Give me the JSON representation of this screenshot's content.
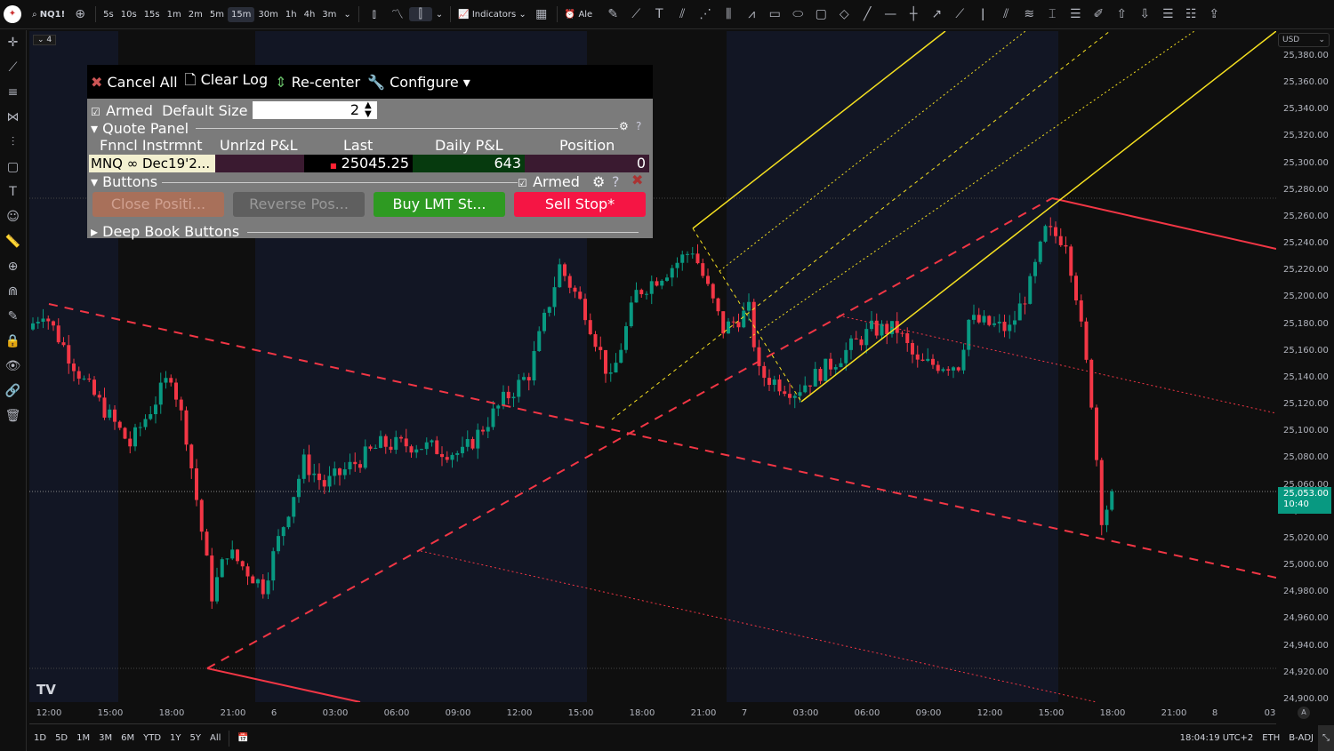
{
  "topbar": {
    "symbol": "NQ1!",
    "intervals": [
      "5s",
      "10s",
      "15s",
      "1m",
      "2m",
      "5m",
      "15m",
      "30m",
      "1h",
      "4h",
      "3m"
    ],
    "selected_interval": "15m",
    "indicators": "Indicators",
    "alert": "Ale"
  },
  "left_tools": [
    "crosshair",
    "trend-line",
    "fib",
    "pattern",
    "prediction",
    "geometric",
    "text",
    "emoji",
    "ruler",
    "zoom-in",
    "magnet",
    "draw-mode",
    "lock",
    "eye",
    "link",
    "trash"
  ],
  "panel": {
    "toolbar": {
      "cancel_all": "Cancel All",
      "clear_log": "Clear Log",
      "recenter": "Re-center",
      "configure": "Configure"
    },
    "armed": "Armed",
    "default_size_label": "Default Size",
    "default_size": "2",
    "quote_panel": "Quote Panel",
    "columns": [
      "Fnncl Instrmnt",
      "Unrlzd P&L",
      "Last",
      "Daily P&L",
      "Position"
    ],
    "quote": {
      "instrument": "MNQ ∞ Dec19'2...",
      "unrealized": "",
      "last": "25045.25",
      "daily_pnl": "643",
      "position": "0"
    },
    "buttons_section": "Buttons",
    "buttons_armed": "Armed",
    "buttons": {
      "close": "Close Positi...",
      "reverse": "Reverse Pos...",
      "buy": "Buy LMT St...",
      "sell": "Sell Stop*"
    },
    "deep_book": "Deep Book Buttons"
  },
  "chart": {
    "legend_collapse": "4",
    "currency": "USD",
    "last_price": "25,053.00",
    "countdown": "10:40",
    "price_labels": [
      "25,380.00",
      "25,360.00",
      "25,340.00",
      "25,320.00",
      "25,300.00",
      "25,280.00",
      "25,260.00",
      "25,240.00",
      "25,220.00",
      "25,200.00",
      "25,180.00",
      "25,160.00",
      "25,140.00",
      "25,120.00",
      "25,100.00",
      "25,080.00",
      "25,060.00",
      "25,040.00",
      "25,020.00",
      "25,000.00",
      "24,980.00",
      "24,960.00",
      "24,940.00",
      "24,920.00",
      "24,900.00"
    ],
    "time_labels": [
      "12:00",
      "15:00",
      "18:00",
      "21:00",
      "6",
      "03:00",
      "06:00",
      "09:00",
      "12:00",
      "15:00",
      "18:00",
      "21:00",
      "7",
      "03:00",
      "06:00",
      "09:00",
      "12:00",
      "15:00",
      "18:00",
      "21:00",
      "8",
      "03"
    ],
    "auto_label": "A"
  },
  "chart_data": {
    "type": "candlestick",
    "symbol": "NQ1!",
    "interval": "15m",
    "ylim": [
      24900,
      25390
    ],
    "waypoints": [
      [
        0,
        25176
      ],
      [
        3,
        25190
      ],
      [
        11,
        25137
      ],
      [
        20,
        25090
      ],
      [
        28,
        25143
      ],
      [
        31,
        25097
      ],
      [
        36,
        24978
      ],
      [
        39,
        25011
      ],
      [
        46,
        24984
      ],
      [
        54,
        25077
      ],
      [
        58,
        25060
      ],
      [
        69,
        25090
      ],
      [
        76,
        25090
      ],
      [
        85,
        25083
      ],
      [
        93,
        25123
      ],
      [
        98,
        25143
      ],
      [
        104,
        25223
      ],
      [
        109,
        25190
      ],
      [
        114,
        25137
      ],
      [
        119,
        25203
      ],
      [
        126,
        25223
      ],
      [
        130,
        25236
      ],
      [
        136,
        25176
      ],
      [
        141,
        25190
      ],
      [
        143,
        25143
      ],
      [
        150,
        25130
      ],
      [
        157,
        25150
      ],
      [
        165,
        25176
      ],
      [
        170,
        25176
      ],
      [
        174,
        25150
      ],
      [
        182,
        25150
      ],
      [
        184,
        25183
      ],
      [
        192,
        25176
      ],
      [
        196,
        25209
      ],
      [
        199,
        25249
      ],
      [
        203,
        25243
      ],
      [
        205,
        25203
      ],
      [
        208,
        25123
      ],
      [
        210,
        25037
      ],
      [
        212,
        25050
      ]
    ]
  },
  "bottombar": {
    "ranges": [
      "1D",
      "5D",
      "1M",
      "3M",
      "6M",
      "YTD",
      "1Y",
      "5Y",
      "All"
    ],
    "clock": "18:04:19 UTC+2",
    "session": "ETH",
    "adj": "B-ADJ"
  }
}
